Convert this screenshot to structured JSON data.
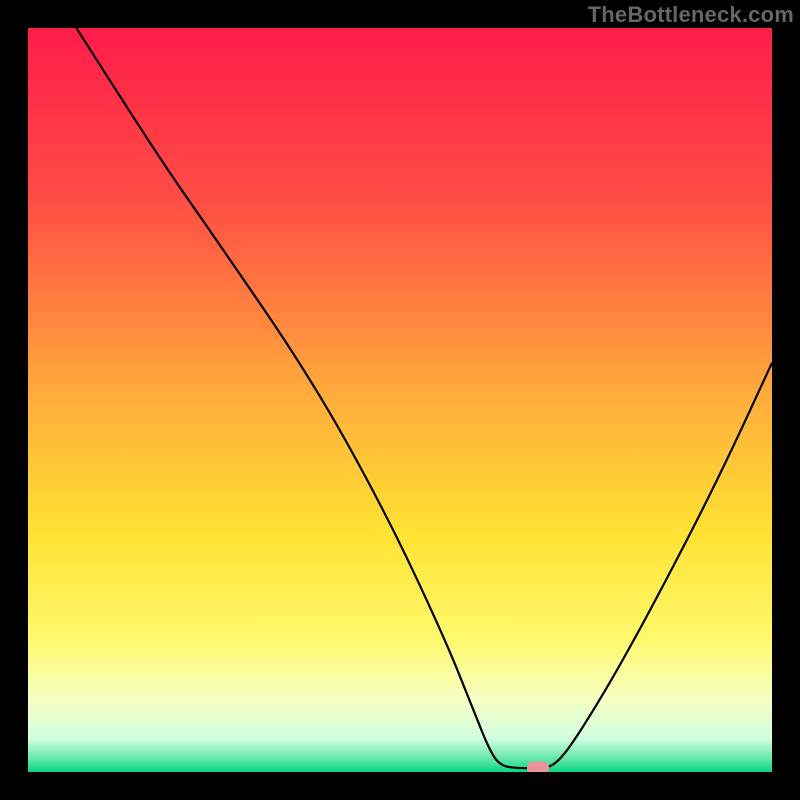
{
  "branding": {
    "watermark": "TheBottleneck.com"
  },
  "chart_data": {
    "type": "line",
    "title": "",
    "xlabel": "",
    "ylabel": "",
    "xlim": [
      0,
      100
    ],
    "ylim": [
      0,
      100
    ],
    "grid": false,
    "gradient_stops": [
      {
        "offset": 0,
        "color": "#ff1c4a"
      },
      {
        "offset": 24,
        "color": "#ff5044"
      },
      {
        "offset": 50,
        "color": "#ffae3c"
      },
      {
        "offset": 68,
        "color": "#ffe233"
      },
      {
        "offset": 82,
        "color": "#fff96c"
      },
      {
        "offset": 90,
        "color": "#f8ffc0"
      },
      {
        "offset": 95.5,
        "color": "#d0ffdf"
      },
      {
        "offset": 98,
        "color": "#6fe8af"
      },
      {
        "offset": 100,
        "color": "#08d784"
      }
    ],
    "curve": [
      {
        "x": 6.5,
        "y": 100
      },
      {
        "x": 18,
        "y": 82
      },
      {
        "x": 25,
        "y": 72
      },
      {
        "x": 38,
        "y": 53
      },
      {
        "x": 48,
        "y": 35
      },
      {
        "x": 56,
        "y": 18
      },
      {
        "x": 60,
        "y": 8
      },
      {
        "x": 62,
        "y": 3
      },
      {
        "x": 63.5,
        "y": 0.8
      },
      {
        "x": 66,
        "y": 0.5
      },
      {
        "x": 69,
        "y": 0.5
      },
      {
        "x": 71,
        "y": 1
      },
      {
        "x": 74,
        "y": 5
      },
      {
        "x": 80,
        "y": 15
      },
      {
        "x": 88,
        "y": 30
      },
      {
        "x": 94,
        "y": 42
      },
      {
        "x": 100,
        "y": 55
      }
    ],
    "marker": {
      "x": 68.5,
      "y": 0.5,
      "color": "#ed9298"
    }
  }
}
